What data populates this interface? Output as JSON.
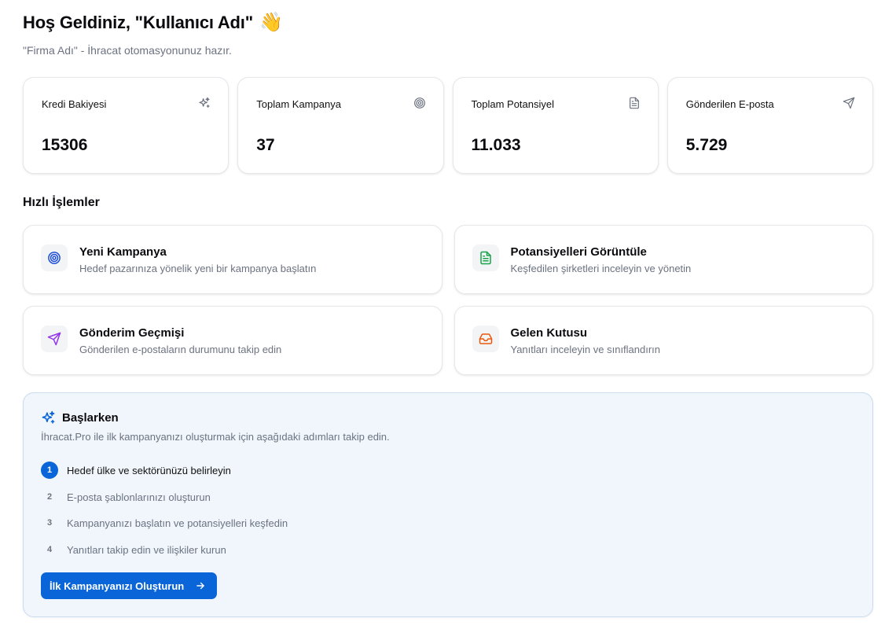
{
  "header": {
    "title": "Hoş Geldiniz, \"Kullanıcı Adı\"",
    "wave_emoji": "👋",
    "subtitle": "\"Firma Adı\" - İhracat otomasyonunuz hazır."
  },
  "stats": [
    {
      "label": "Kredi Bakiyesi",
      "value": "15306",
      "icon": "sparkles-icon"
    },
    {
      "label": "Toplam Kampanya",
      "value": "37",
      "icon": "target-icon"
    },
    {
      "label": "Toplam Potansiyel",
      "value": "11.033",
      "icon": "document-icon"
    },
    {
      "label": "Gönderilen E-posta",
      "value": "5.729",
      "icon": "send-icon"
    }
  ],
  "quick_actions": {
    "title": "Hızlı İşlemler",
    "items": [
      {
        "title": "Yeni Kampanya",
        "description": "Hedef pazarınıza yönelik yeni bir kampanya başlatın",
        "icon": "target-icon",
        "color": "#1d4ed8"
      },
      {
        "title": "Potansiyelleri Görüntüle",
        "description": "Keşfedilen şirketleri inceleyin ve yönetin",
        "icon": "document-icon",
        "color": "#16a34a"
      },
      {
        "title": "Gönderim Geçmişi",
        "description": "Gönderilen e-postaların durumunu takip edin",
        "icon": "send-icon",
        "color": "#9333ea"
      },
      {
        "title": "Gelen Kutusu",
        "description": "Yanıtları inceleyin ve sınıflandırın",
        "icon": "inbox-icon",
        "color": "#ea580c"
      }
    ]
  },
  "getting_started": {
    "title": "Başlarken",
    "description": "İhracat.Pro ile ilk kampanyanızı oluşturmak için aşağıdaki adımları takip edin.",
    "steps": [
      {
        "num": "1",
        "text": "Hedef ülke ve sektörünüzü belirleyin"
      },
      {
        "num": "2",
        "text": "E-posta şablonlarınızı oluşturun"
      },
      {
        "num": "3",
        "text": "Kampanyanızı başlatın ve potansiyelleri keşfedin"
      },
      {
        "num": "4",
        "text": "Yanıtları takip edin ve ilişkiler kurun"
      }
    ],
    "cta_label": "İlk Kampanyanızı Oluşturun"
  },
  "colors": {
    "accent": "#0a66d8",
    "panel_bg": "#f1f6fc"
  }
}
